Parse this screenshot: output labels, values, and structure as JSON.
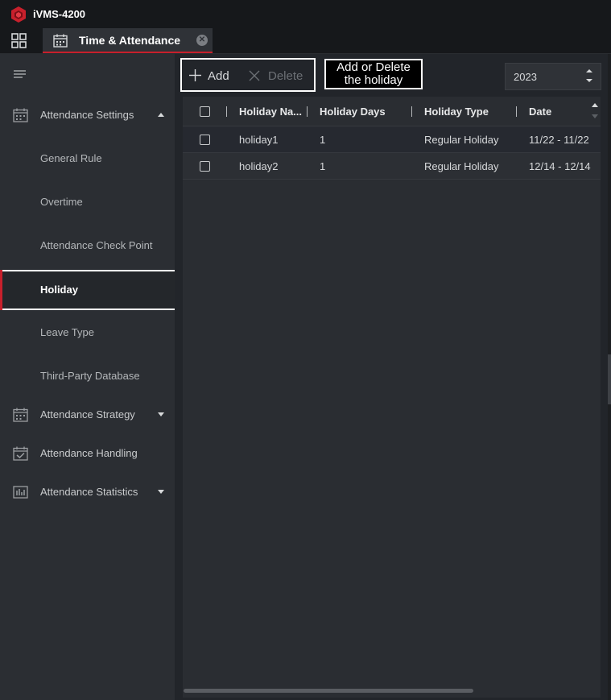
{
  "app": {
    "title": "iVMS-4200"
  },
  "tab": {
    "label": "Time & Attendance"
  },
  "sidebar": {
    "groups": [
      {
        "label": "Attendance Settings",
        "icon": "calendar-icon",
        "expanded": true
      },
      {
        "label": "Attendance Strategy",
        "icon": "calendar-icon",
        "expanded": false
      },
      {
        "label": "Attendance Handling",
        "icon": "calendar-check-icon"
      },
      {
        "label": "Attendance Statistics",
        "icon": "statistics-icon",
        "expanded": false
      }
    ],
    "settings_items": [
      {
        "label": "General Rule"
      },
      {
        "label": "Overtime"
      },
      {
        "label": "Attendance Check Point"
      },
      {
        "label": "Holiday",
        "active": true
      },
      {
        "label": "Leave Type"
      },
      {
        "label": "Third-Party Database"
      }
    ]
  },
  "toolbar": {
    "add_label": "Add",
    "delete_label": "Delete"
  },
  "annotation": {
    "line1": "Add or Delete",
    "line2": "the holiday"
  },
  "year": {
    "value": "2023"
  },
  "table": {
    "columns": [
      "Holiday Na...",
      "Holiday Days",
      "Holiday Type",
      "Date"
    ],
    "rows": [
      {
        "name": "holiday1",
        "days": "1",
        "type": "Regular Holiday",
        "date": "11/22 - 11/22"
      },
      {
        "name": "holiday2",
        "days": "1",
        "type": "Regular Holiday",
        "date": "12/14 - 12/14"
      }
    ]
  },
  "colors": {
    "accent": "#c8202c",
    "background": "#24272b",
    "sidebar": "#2b2e33"
  }
}
